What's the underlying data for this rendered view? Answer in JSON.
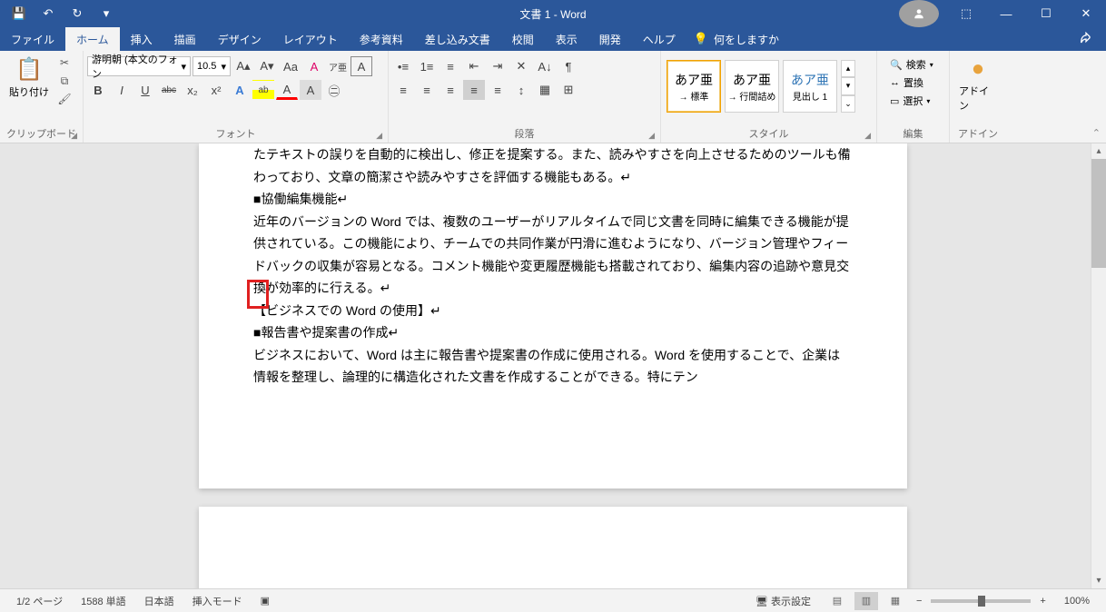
{
  "title": "文書 1 - Word",
  "qat": {
    "save": "💾",
    "undo": "↶",
    "redo": "↻",
    "custom": "▾"
  },
  "win": {
    "ribbon_opts": "⬚",
    "minimize": "—",
    "maximize": "☐",
    "close": "✕"
  },
  "tabs": [
    "ファイル",
    "ホーム",
    "挿入",
    "描画",
    "デザイン",
    "レイアウト",
    "参考資料",
    "差し込み文書",
    "校閲",
    "表示",
    "開発",
    "ヘルプ"
  ],
  "active_tab": 1,
  "tell_me": "何をしますか",
  "ribbon": {
    "clipboard": {
      "label": "クリップボード",
      "paste": "貼り付け"
    },
    "font": {
      "label": "フォント",
      "name": "游明朝 (本文のフォン",
      "size": "10.5",
      "grow": "A▴",
      "shrink": "A▾",
      "case": "Aa",
      "clear": "⌫",
      "phonetic": "ア亜",
      "enclose": "A",
      "bold": "B",
      "italic": "I",
      "underline": "U",
      "strike": "abc",
      "sub": "x₂",
      "sup": "x²",
      "texteffect": "A",
      "highlight": "ab",
      "fontcolor": "A",
      "charshade": "A",
      "charborder": "㊁"
    },
    "para": {
      "label": "段落",
      "bullets": "≣",
      "numbers": "≣",
      "multilevel": "≣",
      "dec_indent": "⇤",
      "inc_indent": "⇥",
      "sort": "A↓",
      "marks": "¶",
      "al": "≡",
      "ac": "≡",
      "ar": "≡",
      "aj": "≡",
      "linespace": "↕",
      "shade": "▦",
      "borders": "⊞",
      "dist": "≡",
      "asian": "⋮"
    },
    "styles": {
      "label": "スタイル",
      "items": [
        {
          "preview": "あア亜",
          "name": "→ 標準"
        },
        {
          "preview": "あア亜",
          "name": "→ 行間詰め"
        },
        {
          "preview": "あア亜",
          "name": "見出し 1"
        }
      ]
    },
    "editing": {
      "label": "編集",
      "find": "検索",
      "replace": "置換",
      "select": "選択"
    },
    "addins": {
      "label": "アドイン",
      "addin": "アドイン"
    }
  },
  "document": {
    "lines": [
      "たテキストの誤りを自動的に検出し、修正を提案する。また、読みやすさを向上させるためのツールも備わっており、文章の簡潔さや読みやすさを評価する機能もある。↵",
      "■協働編集機能↵",
      "近年のバージョンの Word では、複数のユーザーがリアルタイムで同じ文書を同時に編集できる機能が提供されている。この機能により、チームでの共同作業が円滑に進むようになり、バージョン管理やフィードバックの収集が容易となる。コメント機能や変更履歴機能も搭載されており、編集内容の追跡や意見交換が効率的に行える。↵",
      "【ビジネスでの Word の使用】↵",
      "■報告書や提案書の作成↵",
      "ビジネスにおいて、Word は主に報告書や提案書の作成に使用される。Word を使用することで、企業は情報を整理し、論理的に構造化された文書を作成することができる。特にテン"
    ]
  },
  "status": {
    "page": "1/2 ページ",
    "words": "1588 単語",
    "lang": "日本語",
    "mode": "挿入モード",
    "display": "表示設定",
    "zoom": "100%"
  }
}
